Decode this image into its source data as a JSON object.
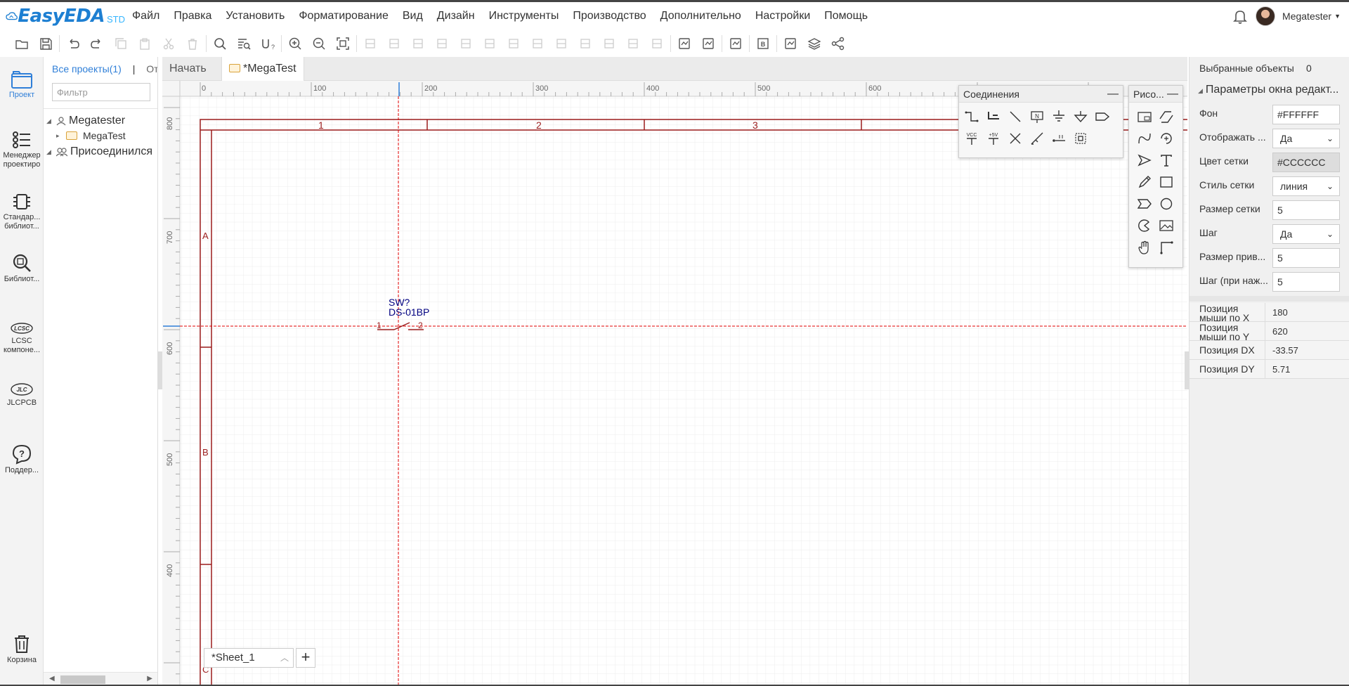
{
  "app": {
    "logo_text": "EasyEDA",
    "logo_suffix": "STD",
    "accent_color": "#2f7fd8",
    "schematic_color": "#9b1c1c",
    "crosshair_color": "#e00000"
  },
  "menu": [
    "Файл",
    "Правка",
    "Установить",
    "Форматирование",
    "Вид",
    "Дизайн",
    "Инструменты",
    "Производство",
    "Дополнительно",
    "Настройки",
    "Помощь"
  ],
  "user": {
    "name": "Megatester"
  },
  "toolbar_icons": [
    "new-folder-icon",
    "save-icon",
    "undo-icon",
    "redo-icon",
    "copy-icon",
    "paste-icon",
    "cut-icon",
    "delete-icon",
    "search-icon",
    "find-component-icon",
    "annotate-icon",
    "zoom-in-icon",
    "zoom-out-icon",
    "fit-icon",
    "rotate-icon",
    "rotate-back-icon",
    "flip-h-icon",
    "flip-v-icon",
    "align-left-icon",
    "align-right-icon",
    "align-top-icon",
    "align-bottom-icon",
    "align-center-h-icon",
    "align-center-v-icon",
    "grid-icon",
    "distribute-h-icon",
    "distribute-v-icon",
    "image-icon",
    "layers-stack-icon",
    "pin-icon",
    "bom-icon",
    "export-image-icon",
    "layers-icon",
    "share-icon"
  ],
  "leftbar": [
    {
      "label": "Проект",
      "icon": "project-folder-icon"
    },
    {
      "label": "Менеджер проектиро",
      "icon": "design-manager-icon"
    },
    {
      "label": "Стандар... библиот...",
      "icon": "chip-icon"
    },
    {
      "label": "Библиот...",
      "icon": "library-search-icon"
    },
    {
      "label": "LCSC компоне...",
      "icon": "lcsc-icon"
    },
    {
      "label": "JLCPCB",
      "icon": "jlc-icon"
    },
    {
      "label": "Поддер...",
      "icon": "help-icon"
    },
    {
      "label": "Корзина",
      "icon": "trash-icon"
    }
  ],
  "project_panel": {
    "tab_all": "Все проекты(1)",
    "tab_sep": "|",
    "tab_other": "Отк",
    "filter_placeholder": "Фильтр",
    "tree": [
      {
        "label": "Megatester",
        "icon": "user-icon"
      },
      {
        "label": "MegaTest",
        "icon": "folder-icon"
      },
      {
        "label": "Присоединился",
        "icon": "users-icon"
      }
    ]
  },
  "tabs": [
    {
      "label": "Начать"
    },
    {
      "label": "*MegaTest"
    }
  ],
  "ruler": {
    "h_labels": [
      "0",
      "100",
      "200",
      "300",
      "400",
      "500",
      "600"
    ],
    "v_labels": [
      "800",
      "700",
      "600",
      "500",
      "400"
    ]
  },
  "frame": {
    "columns": [
      "1",
      "2",
      "3"
    ],
    "rows": [
      "A",
      "B",
      "C"
    ]
  },
  "component": {
    "ref": "SW?",
    "value": "DS-01BP",
    "pin1": "1",
    "pin2": "2"
  },
  "palettes": {
    "wiring_title": "Соединения",
    "drawing_title": "Рисо...",
    "wiring_icons": [
      "wire-icon",
      "bus-icon",
      "bus-entry-icon",
      "net-label-icon",
      "ground-icon",
      "netflag-ground-icon",
      "netport-icon",
      "vcc-icon",
      "plus5v-icon",
      "no-connect-icon",
      "probe-icon",
      "pin-icon",
      "group-icon"
    ],
    "drawing_icons": [
      "pin-panel-icon",
      "polyline-icon",
      "bezier-icon",
      "arc-icon",
      "arrow-icon",
      "text-icon",
      "freehand-icon",
      "rectangle-icon",
      "polygon-icon",
      "circle-icon",
      "pie-icon",
      "image-icon",
      "hand-icon",
      "dimension-icon"
    ],
    "wiring_vcc": "VCC",
    "wiring_5v": "+5V",
    "wiring_n": "N"
  },
  "sheet": {
    "tab_label": "*Sheet_1",
    "add_label": "+"
  },
  "right_panel": {
    "selected_label": "Выбранные объекты",
    "selected_count": "0",
    "section_title": "Параметры окна редакт...",
    "rows": [
      {
        "label": "Фон",
        "value": "#FFFFFF",
        "kind": "input"
      },
      {
        "label": "Отображать ...",
        "value": "Да",
        "kind": "select"
      },
      {
        "label": "Цвет сетки",
        "value": "#CCCCCC",
        "kind": "input-grey"
      },
      {
        "label": "Стиль сетки",
        "value": "линия",
        "kind": "select"
      },
      {
        "label": "Размер сетки",
        "value": "5",
        "kind": "input"
      },
      {
        "label": "Шаг",
        "value": "Да",
        "kind": "select"
      },
      {
        "label": "Размер прив...",
        "value": "5",
        "kind": "input"
      },
      {
        "label": "Шаг (при наж...",
        "value": "5",
        "kind": "input"
      }
    ],
    "positions": [
      {
        "label": "Позиция мыши по X",
        "value": "180"
      },
      {
        "label": "Позиция мыши по Y",
        "value": "620"
      },
      {
        "label": "Позиция DX",
        "value": "-33.57"
      },
      {
        "label": "Позиция DY",
        "value": "5.71"
      }
    ]
  }
}
